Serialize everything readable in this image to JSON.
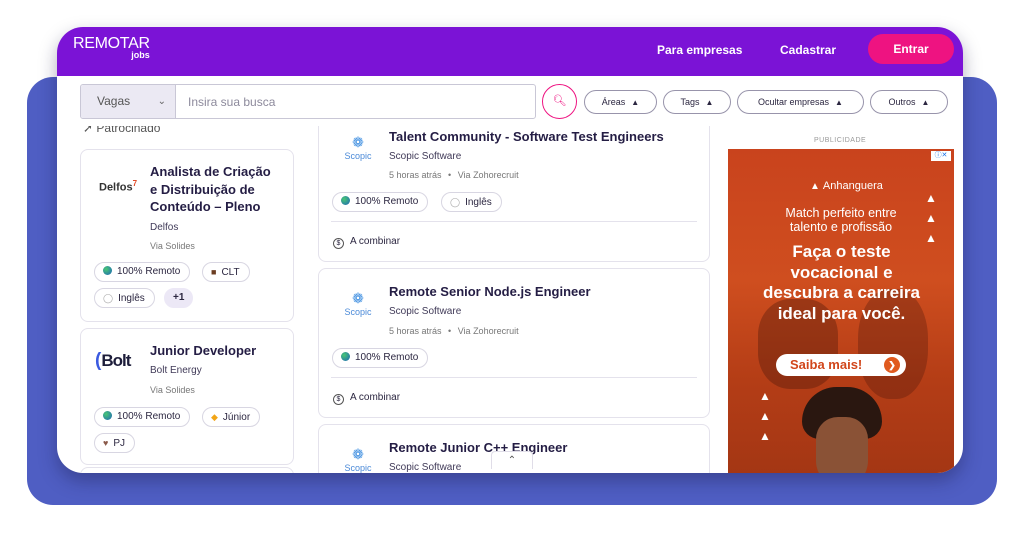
{
  "header": {
    "logo_main": "REMOTAR",
    "logo_sub": "jobs",
    "nav": [
      "Para empresas",
      "Cadastrar"
    ],
    "login_label": "Entrar",
    "brand_color": "#7b13d6",
    "accent_color": "#ee1381"
  },
  "search": {
    "type_value": "Vagas",
    "placeholder": "Insira sua busca",
    "value": "",
    "button_icon": "search-icon",
    "filters": [
      "Áreas",
      "Tags",
      "Ocultar empresas",
      "Outros"
    ]
  },
  "sponsored_label": "Patrocinado",
  "left_cards": [
    {
      "logo": "Delfos",
      "title_lines": [
        "Analista de Criação",
        "e Distribuição de",
        "Conteúdo – Pleno"
      ],
      "company": "Delfos",
      "via": "Via Solides",
      "tags": [
        "100% Remoto",
        "CLT",
        "Inglês",
        "+1"
      ]
    },
    {
      "logo": "Bolt",
      "title": "Junior Developer",
      "company": "Bolt Energy",
      "via": "Via Solides",
      "tags": [
        "100% Remoto",
        "Júnior",
        "PJ"
      ]
    }
  ],
  "jobs": [
    {
      "logo": "Scopic",
      "title": "Talent Community - Software Test Engineers",
      "company": "Scopic Software",
      "time": "5 horas atrás",
      "via": "Via Zohorecruit",
      "tags": [
        "100% Remoto",
        "Inglês"
      ],
      "salary": "A combinar"
    },
    {
      "logo": "Scopic",
      "title": "Remote Senior Node.js Engineer",
      "company": "Scopic Software",
      "time": "5 horas atrás",
      "via": "Via Zohorecruit",
      "tags": [
        "100% Remoto"
      ],
      "salary": "A combinar"
    },
    {
      "logo": "Scopic",
      "title": "Remote Junior C++ Engineer",
      "company": "Scopic Software"
    }
  ],
  "ad": {
    "label": "PUBLICIDADE",
    "brand": "Anhanguera",
    "subtitle": "Match perfeito entre talento e profissão",
    "headline": "Faça o teste vocacional e descubra a carreira ideal para você.",
    "cta": "Saiba mais!",
    "bg_color": "#c9431d"
  }
}
